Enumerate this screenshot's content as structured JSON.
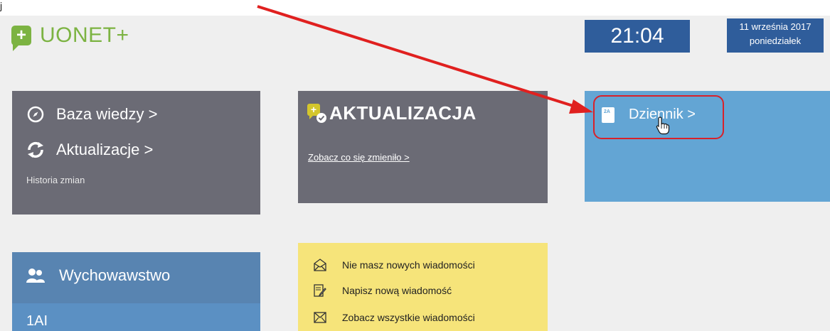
{
  "top_strip_tail": "j",
  "header": {
    "logo_glyph": "+",
    "app_name": "UONET+",
    "clock": "21:04",
    "date_line1": "11 września 2017",
    "date_line2": "poniedziałek"
  },
  "knowledge_tile": {
    "knowledge_label": "Baza wiedzy >",
    "updates_label": "Aktualizacje >",
    "history_label": "Historia zmian"
  },
  "update_tile": {
    "title": "AKTUALIZACJA",
    "link": "Zobacz co się zmieniło >"
  },
  "diary_tile": {
    "label": "Dziennik >"
  },
  "class_tile": {
    "title": "Wychowawstwo",
    "class_name": "1AI"
  },
  "messages_tile": {
    "items": [
      {
        "label": "Nie masz nowych wiadomości",
        "icon": "envelope-open-icon"
      },
      {
        "label": "Napisz nową wiadomość",
        "icon": "write-message-icon"
      },
      {
        "label": "Zobacz wszystkie wiadomości",
        "icon": "envelope-icon"
      }
    ]
  },
  "colors": {
    "brand_green": "#7cb342",
    "dark_tile": "#6b6b75",
    "blue_tile": "#63a5d4",
    "header_blue": "#2f5d9b",
    "yellow_tile": "#f6e47a",
    "annotation_red": "#d8212a"
  }
}
